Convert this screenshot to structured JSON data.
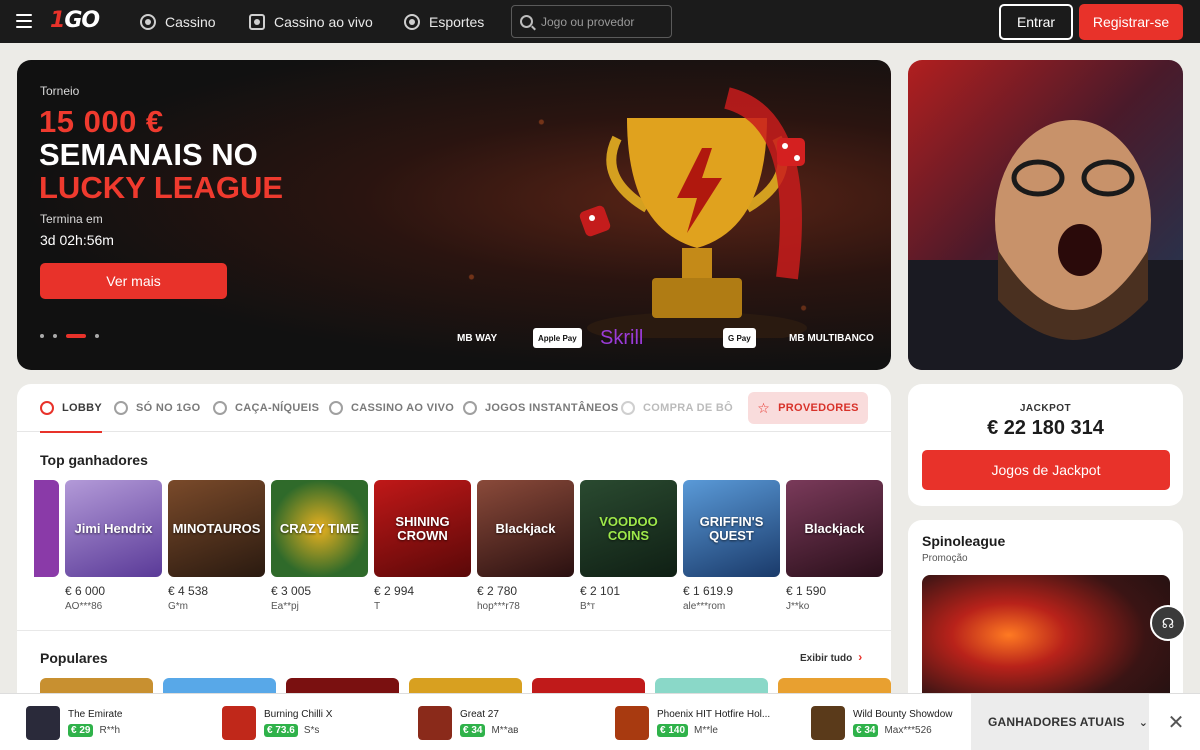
{
  "header": {
    "logo": "1GO",
    "nav": [
      {
        "label": "Cassino",
        "icon": "casino-chip-icon"
      },
      {
        "label": "Cassino ao vivo",
        "icon": "live-casino-icon"
      },
      {
        "label": "Esportes",
        "icon": "soccer-ball-icon"
      }
    ],
    "search_placeholder": "Jogo ou provedor",
    "login_label": "Entrar",
    "register_label": "Registrar-se"
  },
  "hero": {
    "kicker": "Torneio",
    "amount": "15 000 €",
    "line2": "SEMANAIS NO",
    "line3": "LUCKY LEAGUE",
    "ends_label": "Termina em",
    "timer": "3d 02h:56m",
    "button": "Ver mais",
    "payments": [
      "MB WAY",
      "Apple Pay",
      "Skrill",
      "G Pay",
      "MB MULTIBANCO"
    ]
  },
  "categories": {
    "tabs": [
      "LOBBY",
      "SÓ NO 1GO",
      "CAÇA-NÍQUEIS",
      "CASSINO AO VIVO",
      "JOGOS INSTANTÂNEOS",
      "COMPRA DE BÔ"
    ],
    "providers_button": "PROVEDORES"
  },
  "top_winners": {
    "title": "Top ganhadores",
    "items": [
      {
        "game": "Jimi Hendrix",
        "amount": "€ 6 000",
        "user": "AO***86",
        "color": "#6a4aa8"
      },
      {
        "game": "MINOTAUROS",
        "amount": "€ 4 538",
        "user": "G*m",
        "color": "#4a2a1a"
      },
      {
        "game": "CRAZY TIME",
        "amount": "€ 3 005",
        "user": "Ea**pj",
        "color": "#3f6e2a"
      },
      {
        "game": "SHINING CROWN",
        "amount": "€ 2 994",
        "user": "T",
        "color": "#8a1212"
      },
      {
        "game": "Blackjack",
        "amount": "€ 2 780",
        "user": "hop***r78",
        "color": "#5a2a2a"
      },
      {
        "game": "VOODOO COINS",
        "amount": "€ 2 101",
        "user": "B*т",
        "color": "#1f3a28"
      },
      {
        "game": "GRIFFIN'S QUEST",
        "amount": "€ 1 619.9",
        "user": "ale***rom",
        "color": "#2a5a8a"
      },
      {
        "game": "Blackjack",
        "amount": "€ 1 590",
        "user": "J**ko",
        "color": "#5a2030"
      }
    ]
  },
  "popular": {
    "title": "Populares",
    "see_all": "Exibir tudo"
  },
  "jackpot": {
    "label": "JACKPOT",
    "amount": "€ 22 180 314",
    "button": "Jogos de Jackpot"
  },
  "spinoleague": {
    "title": "Spinoleague",
    "subtitle": "Promoção"
  },
  "bottom_bar": {
    "items": [
      {
        "game": "The Emirate",
        "amount": "€ 29",
        "user": "R**h",
        "color": "#2a2a3a"
      },
      {
        "game": "Burning Chilli X",
        "amount": "€ 73.6",
        "user": "S*s",
        "color": "#c0281a"
      },
      {
        "game": "Great 27",
        "amount": "€ 34",
        "user": "M**ав",
        "color": "#8a2a1a"
      },
      {
        "game": "Phoenix HIT Hotfire Hol...",
        "amount": "€ 140",
        "user": "M**le",
        "color": "#a83a10"
      },
      {
        "game": "Wild Bounty Showdow",
        "amount": "€ 34",
        "user": "Max***526",
        "color": "#5a3a1a"
      }
    ],
    "select_label": "GANHADORES ATUAIS"
  }
}
